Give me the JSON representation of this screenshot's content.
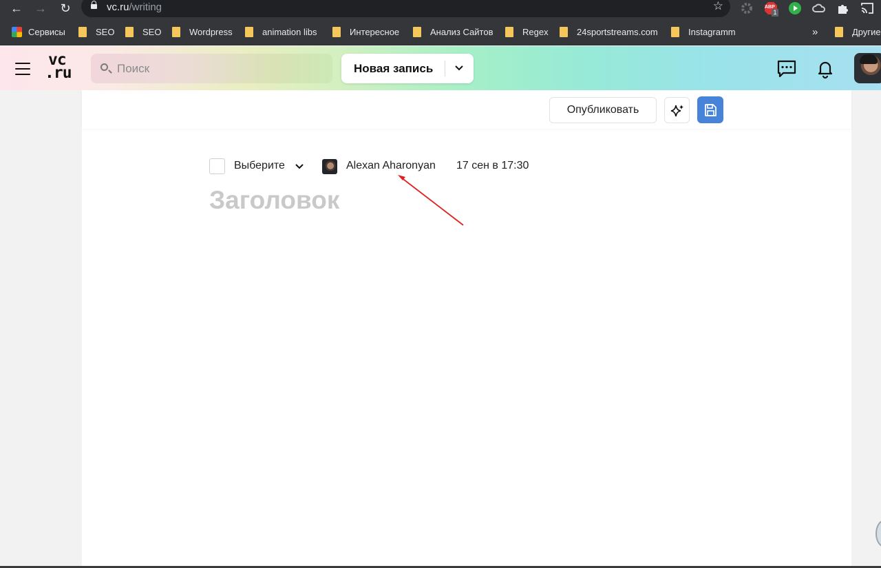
{
  "browser": {
    "url_host": "vc.ru",
    "url_path": "/writing",
    "bookmarks": [
      {
        "label": "Сервисы",
        "icon": "apps-grid-icon"
      },
      {
        "label": "SEO",
        "icon": "folder-icon"
      },
      {
        "label": "SEO",
        "icon": "folder-icon"
      },
      {
        "label": "Wordpress",
        "icon": "folder-icon"
      },
      {
        "label": "animation libs",
        "icon": "folder-icon"
      },
      {
        "label": "Интересное",
        "icon": "folder-icon"
      },
      {
        "label": "Анализ Сайтов",
        "icon": "folder-icon"
      },
      {
        "label": "Regex",
        "icon": "folder-icon"
      },
      {
        "label": "24sportstreams.com",
        "icon": "folder-icon"
      },
      {
        "label": "Instagramm",
        "icon": "folder-icon"
      }
    ],
    "overflow": "»",
    "other_bookmarks": "Другие",
    "abp_badge": "ABP",
    "abp_count": "1"
  },
  "header": {
    "logo_line1": "vc",
    "logo_line2": ".ru",
    "search_placeholder": "Поиск",
    "new_post_label": "Новая запись"
  },
  "editor": {
    "publish_label": "Опубликовать",
    "subsite_select": "Выберите",
    "author_name": "Alexan Aharonyan",
    "date": "17 сен в 17:30",
    "title_placeholder": "Заголовок"
  },
  "colors": {
    "save_button": "#4683d9",
    "annotation_arrow": "#e0201e"
  }
}
